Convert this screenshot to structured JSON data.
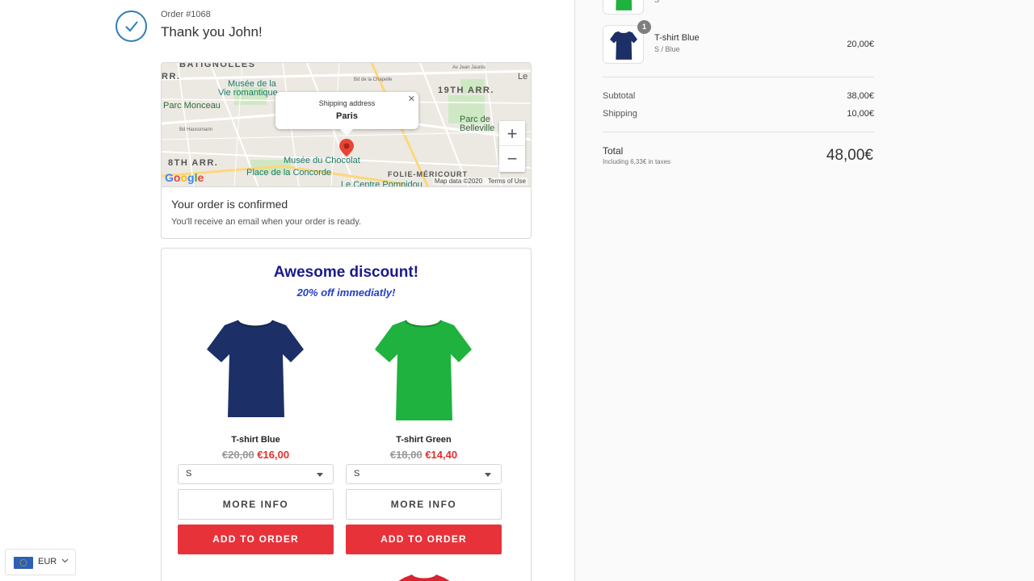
{
  "header": {
    "order_number": "Order #1068",
    "thank_you": "Thank you John!"
  },
  "map": {
    "labels": {
      "batignolles": "BATIGNOLLES",
      "arr17": "RR.",
      "musee_vie": "Musée de la",
      "vie_romantique": "Vie romantique",
      "parc_monceau": "Parc Monceau",
      "arr19": "19TH ARR.",
      "parc_belleville_1": "Parc de",
      "parc_belleville_2": "Belleville",
      "arr8": "8TH ARR.",
      "musee_chocolat": "Musée du Chocolat",
      "place_concorde": "Place de la Concorde",
      "folie": "FOLIE-MÉRICOURT",
      "pompidou": "Le Centre Pompidou",
      "bd_chapelle": "Bd de la Chapelle",
      "av_jean_jaures": "Av Jean Jaurès",
      "bd_haussmann": "Bd Haussmann",
      "le_pre": "Le P"
    },
    "popup_title": "Shipping address",
    "popup_city": "Paris",
    "zoom_in": "+",
    "zoom_out": "−",
    "attribution": "Map data ©2020",
    "terms": "Terms of Use"
  },
  "confirmation": {
    "title": "Your order is confirmed",
    "text": "You'll receive an email when your order is ready."
  },
  "discount": {
    "title": "Awesome discount!",
    "subtitle": "20% off immediatly!",
    "products": [
      {
        "name": "T-shirt Blue",
        "old_price": "€20,00",
        "new_price": "€16,00",
        "size": "S",
        "more_label": "MORE INFO",
        "add_label": "ADD TO ORDER",
        "color": "#1c2f66"
      },
      {
        "name": "T-shirt Green",
        "old_price": "€18,00",
        "new_price": "€14,40",
        "size": "S",
        "more_label": "MORE INFO",
        "add_label": "ADD TO ORDER",
        "color": "#1fb23e"
      }
    ]
  },
  "currency": {
    "code": "EUR"
  },
  "summary": {
    "items": [
      {
        "name": "",
        "variant": "S",
        "price": "",
        "color": "#1fb23e"
      },
      {
        "name": "T-shirt Blue",
        "variant": "S / Blue",
        "price": "20,00€",
        "quantity": "1",
        "color": "#1c2f66"
      }
    ],
    "subtotal_label": "Subtotal",
    "subtotal": "38,00€",
    "shipping_label": "Shipping",
    "shipping": "10,00€",
    "total_label": "Total",
    "tax_note": "Including 6,33€ in taxes",
    "total": "48,00€"
  },
  "colors": {
    "accent_red": "#e8323a",
    "discount_title": "#1a1a8c",
    "discount_subtitle": "#2540c8",
    "check_blue": "#2a7fb8"
  }
}
